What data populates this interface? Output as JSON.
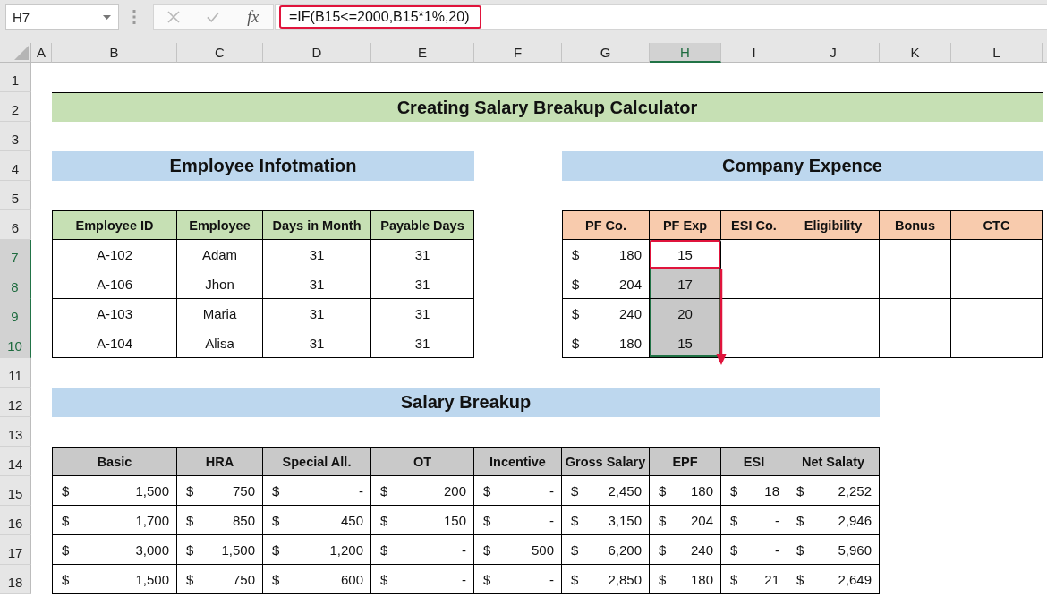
{
  "formula_bar": {
    "name_box": "H7",
    "buttons": [
      {
        "kind": "cancel",
        "disabled": true
      },
      {
        "kind": "enter",
        "disabled": true
      },
      {
        "kind": "function",
        "label": "fx",
        "disabled": false
      }
    ],
    "formula": "=IF(B15<=2000,B15*1%,20)",
    "highlighted": true
  },
  "column_headers": [
    {
      "label": "A",
      "selected": false
    },
    {
      "label": "B",
      "selected": false
    },
    {
      "label": "C",
      "selected": false
    },
    {
      "label": "D",
      "selected": false
    },
    {
      "label": "E",
      "selected": false
    },
    {
      "label": "F",
      "selected": false
    },
    {
      "label": "G",
      "selected": false
    },
    {
      "label": "H",
      "selected": true
    },
    {
      "label": "I",
      "selected": false
    },
    {
      "label": "J",
      "selected": false
    },
    {
      "label": "K",
      "selected": false
    },
    {
      "label": "L",
      "selected": false
    }
  ],
  "row_headers": [
    {
      "label": "1",
      "selected": false
    },
    {
      "label": "2",
      "selected": false
    },
    {
      "label": "3",
      "selected": false
    },
    {
      "label": "4",
      "selected": false
    },
    {
      "label": "5",
      "selected": false
    },
    {
      "label": "6",
      "selected": false
    },
    {
      "label": "7",
      "selected": true
    },
    {
      "label": "8",
      "selected": true
    },
    {
      "label": "9",
      "selected": true
    },
    {
      "label": "10",
      "selected": true
    },
    {
      "label": "11",
      "selected": false
    },
    {
      "label": "12",
      "selected": false
    },
    {
      "label": "13",
      "selected": false
    },
    {
      "label": "14",
      "selected": false
    },
    {
      "label": "15",
      "selected": false
    },
    {
      "label": "16",
      "selected": false
    },
    {
      "label": "17",
      "selected": false
    },
    {
      "label": "18",
      "selected": false
    }
  ],
  "sheet_title": "Creating Salary Breakup Calculator",
  "employee_information": {
    "title": "Employee Infotmation",
    "columns": [
      "Employee ID",
      "Employee",
      "Days in Month",
      "Payable Days"
    ],
    "rows": [
      [
        "A-102",
        "Adam",
        "31",
        "31"
      ],
      [
        "A-106",
        "Jhon",
        "31",
        "31"
      ],
      [
        "A-103",
        "Maria",
        "31",
        "31"
      ],
      [
        "A-104",
        "Alisa",
        "31",
        "31"
      ]
    ]
  },
  "company_expence": {
    "title": "Company Expence",
    "columns": [
      "PF Co.",
      "PF Exp",
      "ESI Co.",
      "Eligibility",
      "Bonus",
      "CTC"
    ],
    "rows": [
      {
        "pf_co": {
          "symbol": "$",
          "amount": "180"
        },
        "pf_exp": {
          "value": "15",
          "selected": true,
          "active": true,
          "highlighted": true
        }
      },
      {
        "pf_co": {
          "symbol": "$",
          "amount": "204"
        },
        "pf_exp": {
          "value": "17",
          "selected": true,
          "active": false,
          "highlighted": false
        }
      },
      {
        "pf_co": {
          "symbol": "$",
          "amount": "240"
        },
        "pf_exp": {
          "value": "20",
          "selected": true,
          "active": false,
          "highlighted": false
        }
      },
      {
        "pf_co": {
          "symbol": "$",
          "amount": "180"
        },
        "pf_exp": {
          "value": "15",
          "selected": true,
          "active": false,
          "highlighted": false
        }
      }
    ],
    "fill_arrow": true
  },
  "salary_breakup": {
    "title": "Salary Breakup",
    "columns": [
      "Basic",
      "HRA",
      "Special All.",
      "OT",
      "Incentive",
      "Gross Salary",
      "EPF",
      "ESI",
      "Net Salaty"
    ],
    "rows": [
      [
        {
          "symbol": "$",
          "amount": "1,500"
        },
        {
          "symbol": "$",
          "amount": "750"
        },
        {
          "symbol": "$",
          "amount": "-"
        },
        {
          "symbol": "$",
          "amount": "200"
        },
        {
          "symbol": "$",
          "amount": "-"
        },
        {
          "symbol": "$",
          "amount": "2,450"
        },
        {
          "symbol": "$",
          "amount": "180"
        },
        {
          "symbol": "$",
          "amount": "18"
        },
        {
          "symbol": "$",
          "amount": "2,252"
        }
      ],
      [
        {
          "symbol": "$",
          "amount": "1,700"
        },
        {
          "symbol": "$",
          "amount": "850"
        },
        {
          "symbol": "$",
          "amount": "450"
        },
        {
          "symbol": "$",
          "amount": "150"
        },
        {
          "symbol": "$",
          "amount": "-"
        },
        {
          "symbol": "$",
          "amount": "3,150"
        },
        {
          "symbol": "$",
          "amount": "204"
        },
        {
          "symbol": "$",
          "amount": "-"
        },
        {
          "symbol": "$",
          "amount": "2,946"
        }
      ],
      [
        {
          "symbol": "$",
          "amount": "3,000"
        },
        {
          "symbol": "$",
          "amount": "1,500"
        },
        {
          "symbol": "$",
          "amount": "1,200"
        },
        {
          "symbol": "$",
          "amount": "-"
        },
        {
          "symbol": "$",
          "amount": "500"
        },
        {
          "symbol": "$",
          "amount": "6,200"
        },
        {
          "symbol": "$",
          "amount": "240"
        },
        {
          "symbol": "$",
          "amount": "-"
        },
        {
          "symbol": "$",
          "amount": "5,960"
        }
      ],
      [
        {
          "symbol": "$",
          "amount": "1,500"
        },
        {
          "symbol": "$",
          "amount": "750"
        },
        {
          "symbol": "$",
          "amount": "600"
        },
        {
          "symbol": "$",
          "amount": "-"
        },
        {
          "symbol": "$",
          "amount": "-"
        },
        {
          "symbol": "$",
          "amount": "2,850"
        },
        {
          "symbol": "$",
          "amount": "180"
        },
        {
          "symbol": "$",
          "amount": "21"
        },
        {
          "symbol": "$",
          "amount": "2,649"
        }
      ]
    ]
  }
}
